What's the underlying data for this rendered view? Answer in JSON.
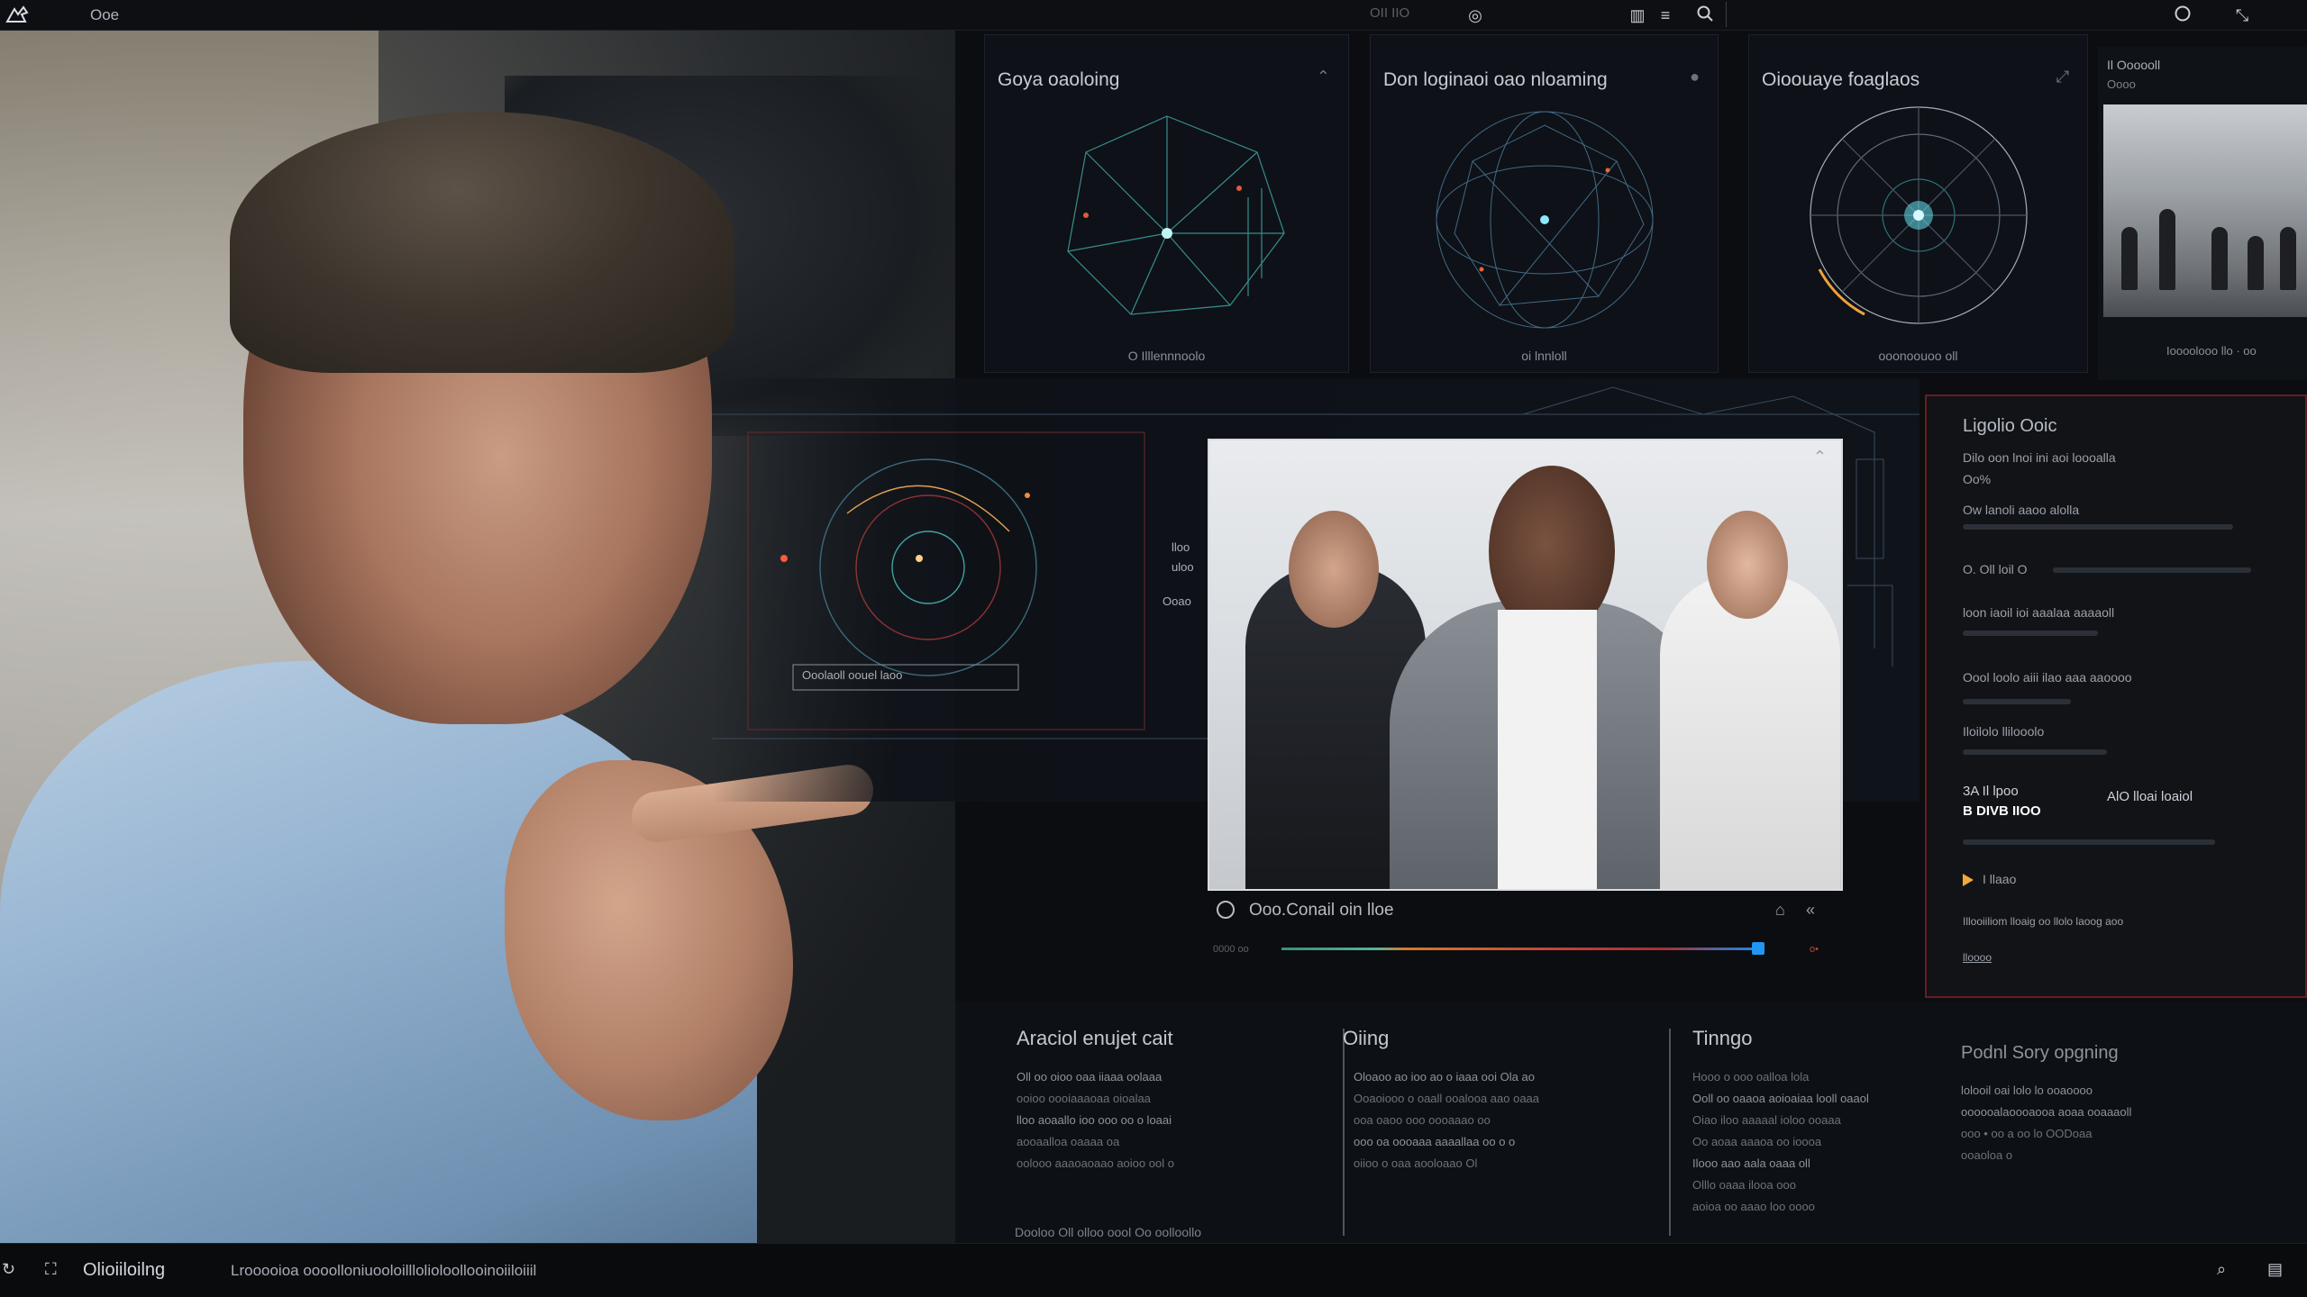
{
  "topbar": {
    "title": "Ooe",
    "center_label": "OII IIO",
    "icons": [
      "app-logo-icon",
      "share-icon",
      "layout-icon",
      "menu-icon",
      "search-icon",
      "record-icon",
      "collapse-icon"
    ]
  },
  "cards": [
    {
      "title": "Goya oaoloing",
      "caption": "O Illlennnoolo"
    },
    {
      "title": "Don loginaoi oao nloaming",
      "caption": "oi lnnloll"
    },
    {
      "title": "Oioouaye foaglaos",
      "caption": "ooonoouoo oll"
    }
  ],
  "thumbnail": {
    "label": "Il Oooooll",
    "sub": "Oooo",
    "caption": "Ioooolooo llo · oo"
  },
  "blueprint": {
    "label": "Ooolaoll oouel laoo",
    "side_labels": [
      "lloo",
      "uloo",
      "Ooao"
    ]
  },
  "video": {
    "title": "Ooo.Conail oin lloe",
    "time_start": "0000 oo",
    "time_end": "o•"
  },
  "insight": {
    "heading": "Ligolio Ooic",
    "line1": "Dilo oon lnoi ini aoi loooalla",
    "line2": "Oo%",
    "line3": "Ow lanoli aaoo alolla",
    "line4": "O. Oll loil O",
    "line5": "loon iaoil ioi aaalaa aaaaoll",
    "line6": "Oool loolo aiii ilao aaa aaoooo",
    "line7": "Iloilolo llilooolo",
    "chip1": "3A  Il lpoo",
    "chip1b": "B DIVB  IIOO",
    "chip2": "AlO lloai loaiol",
    "arrow_label": "I llaao",
    "line8": "Illooiiliom lloaig oo  llolo laoog aoo",
    "footer": "lloooo"
  },
  "bottom": {
    "col1": {
      "heading": "Araciol enujet cait",
      "lines": [
        "Oll oo oioo oaa iiaaa oolaaa",
        "ooioo oooiaaaoaa oioalaa",
        "lloo aoaallo ioo ooo oo o loaai",
        "aooaalloa oaaaa oa",
        "oolooo aaaoaoaao aoioo ool o"
      ]
    },
    "col2": {
      "heading": "Oiing",
      "lines": [
        "Oloaoo ao ioo ao o iaaa ooi Ola ao",
        "Ooaoiooo o oaall ooalooa aao oaaa",
        "ooa oaoo ooo oooaaao oo",
        "ooo oa oooaaa aaaallaa oo o o",
        "oiioo o oaa aooloaao Ol"
      ]
    },
    "col3": {
      "heading": "Tinngo",
      "lines": [
        "Hooo o ooo oalloa lola",
        "Ooll oo oaaoa aoioaiaa looll oaaol",
        "Oiao iloo aaaaal ioloo ooaaa",
        "Oo aoaa aaaoa oo ioooa",
        "Ilooo aao aala oaaa oll",
        "Olllo oaaa ilooa ooo",
        "aoioa oo aaao loo oooo"
      ]
    },
    "col4": {
      "heading": "Podnl Sory opgning",
      "lines": [
        "lolooil oai lolo lo ooaoooo",
        "oooooalaoooaooa aoaa ooaaaoll",
        "ooo • oo a oo lo OODoaa",
        "ooaoloa o"
      ]
    },
    "footer": "Dooloo Oll olloo oool Oo oolloollo"
  },
  "statusbar": {
    "name": "Olioiiloilng",
    "path": "Lrooooioa oooolloniuooloilllolioloollooinoiiloiiil"
  }
}
